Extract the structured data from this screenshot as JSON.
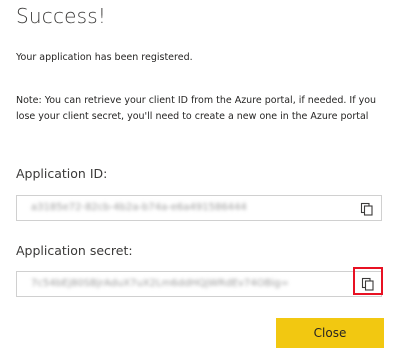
{
  "dialog": {
    "title": "Success!",
    "message": "Your application has been registered.",
    "note": "Note: You can retrieve your client ID from the Azure portal, if needed. If you lose your client secret, you'll need to create a new one in the Azure portal"
  },
  "application_id": {
    "label": "Application ID:",
    "value": "a3185e72-82cb-4b2a-b74a-e6a491586444",
    "copy_icon": "copy-icon"
  },
  "application_secret": {
    "label": "Application secret:",
    "value": "7c54bEj80SBjrAduX7uX2Lm6ddHQjWRdEv74OBig=",
    "copy_icon": "copy-icon"
  },
  "footer": {
    "close_label": "Close"
  },
  "colors": {
    "accent": "#f2c811",
    "highlight": "#e81123"
  }
}
